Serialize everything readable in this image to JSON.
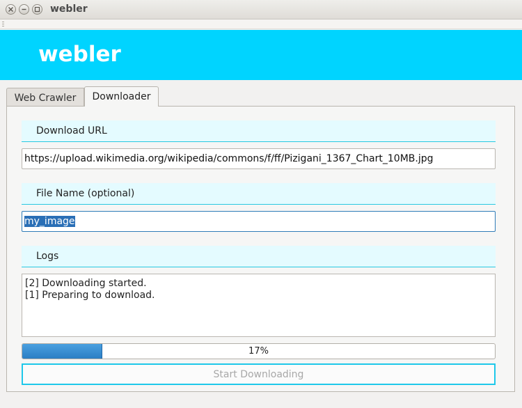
{
  "window": {
    "title": "webler",
    "buttons": [
      "close-icon",
      "minimize-icon",
      "maximize-icon"
    ]
  },
  "header": {
    "title": "webler",
    "bg_color": "#00d4ff"
  },
  "tabs": [
    {
      "label": "Web Crawler",
      "active": false
    },
    {
      "label": "Downloader",
      "active": true
    }
  ],
  "downloader": {
    "url_label": "Download URL",
    "url_value": "https://upload.wikimedia.org/wikipedia/commons/f/ff/Pizigani_1367_Chart_10MB.jpg",
    "filename_label": "File Name (optional)",
    "filename_value": "my_image",
    "logs_label": "Logs",
    "logs": [
      "[2] Downloading started.",
      "[1] Preparing to download."
    ],
    "progress_percent": 17,
    "progress_text": "17%",
    "start_button": "Start Downloading"
  },
  "colors": {
    "accent": "#00d4ff",
    "section_bg": "#e4fbff",
    "progress": "#2b7ec4"
  }
}
